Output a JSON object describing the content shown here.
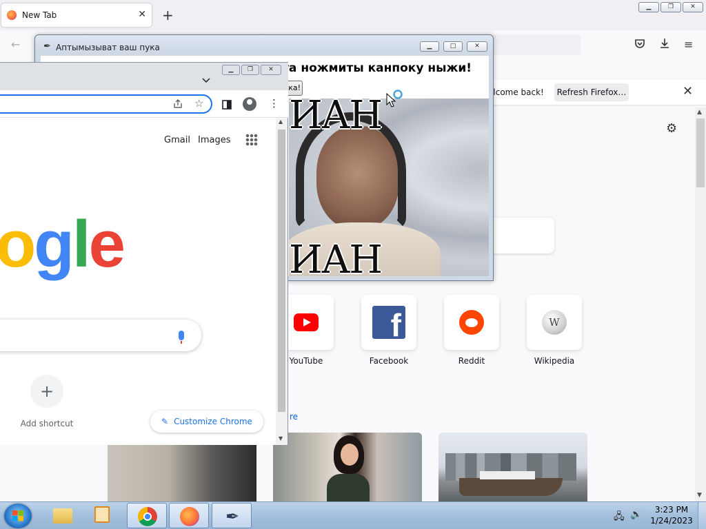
{
  "firefox": {
    "tab_title": "New Tab",
    "tab_close": "✕",
    "new_tab": "+",
    "notice_text": "elcome back!",
    "refresh_button": "Refresh Firefox…",
    "notice_close": "✕",
    "tiles": [
      {
        "label": "YouTube",
        "icon": "youtube-icon"
      },
      {
        "label": "Facebook",
        "icon": "facebook-icon"
      },
      {
        "label": "Reddit",
        "icon": "reddit-icon"
      },
      {
        "label": "Wikipedia",
        "icon": "wikipedia-icon"
      }
    ],
    "more_link": "re"
  },
  "popup": {
    "title": "Аптымызыват ваш пука",
    "heading": "ста ножмиты канпоку ныжи!",
    "button_label": "ка!",
    "caption_top": "ИАН",
    "caption_bottom": "ИАН"
  },
  "chrome": {
    "links": {
      "gmail": "Gmail",
      "images": "Images"
    },
    "logo": [
      {
        "ch": "o",
        "color": "#fbbc05"
      },
      {
        "ch": "g",
        "color": "#4285f4"
      },
      {
        "ch": "l",
        "color": "#34a853"
      },
      {
        "ch": "e",
        "color": "#ea4335"
      }
    ],
    "add_shortcut": "Add shortcut",
    "customize": "Customize Chrome"
  },
  "taskbar": {
    "time": "3:23 PM",
    "date": "1/24/2023"
  }
}
